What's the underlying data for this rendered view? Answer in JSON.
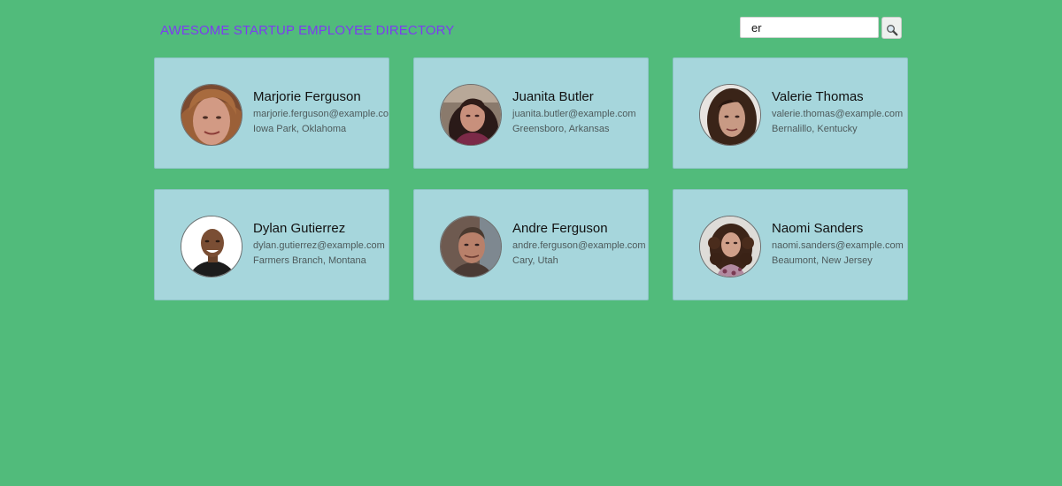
{
  "header": {
    "title": "AWESOME STARTUP EMPLOYEE DIRECTORY"
  },
  "search": {
    "value": "er",
    "button_icon": "magnifier-icon"
  },
  "colors": {
    "background": "#51bb7b",
    "title": "#7c3cf0",
    "card": "#a6d6dc"
  },
  "employees": [
    {
      "name": "Marjorie Ferguson",
      "email": "marjorie.ferguson@example.com",
      "location": "Iowa Park, Oklahoma"
    },
    {
      "name": "Juanita Butler",
      "email": "juanita.butler@example.com",
      "location": "Greensboro, Arkansas"
    },
    {
      "name": "Valerie Thomas",
      "email": "valerie.thomas@example.com",
      "location": "Bernalillo, Kentucky"
    },
    {
      "name": "Dylan Gutierrez",
      "email": "dylan.gutierrez@example.com",
      "location": "Farmers Branch, Montana"
    },
    {
      "name": "Andre Ferguson",
      "email": "andre.ferguson@example.com",
      "location": "Cary, Utah"
    },
    {
      "name": "Naomi Sanders",
      "email": "naomi.sanders@example.com",
      "location": "Beaumont, New Jersey"
    }
  ]
}
